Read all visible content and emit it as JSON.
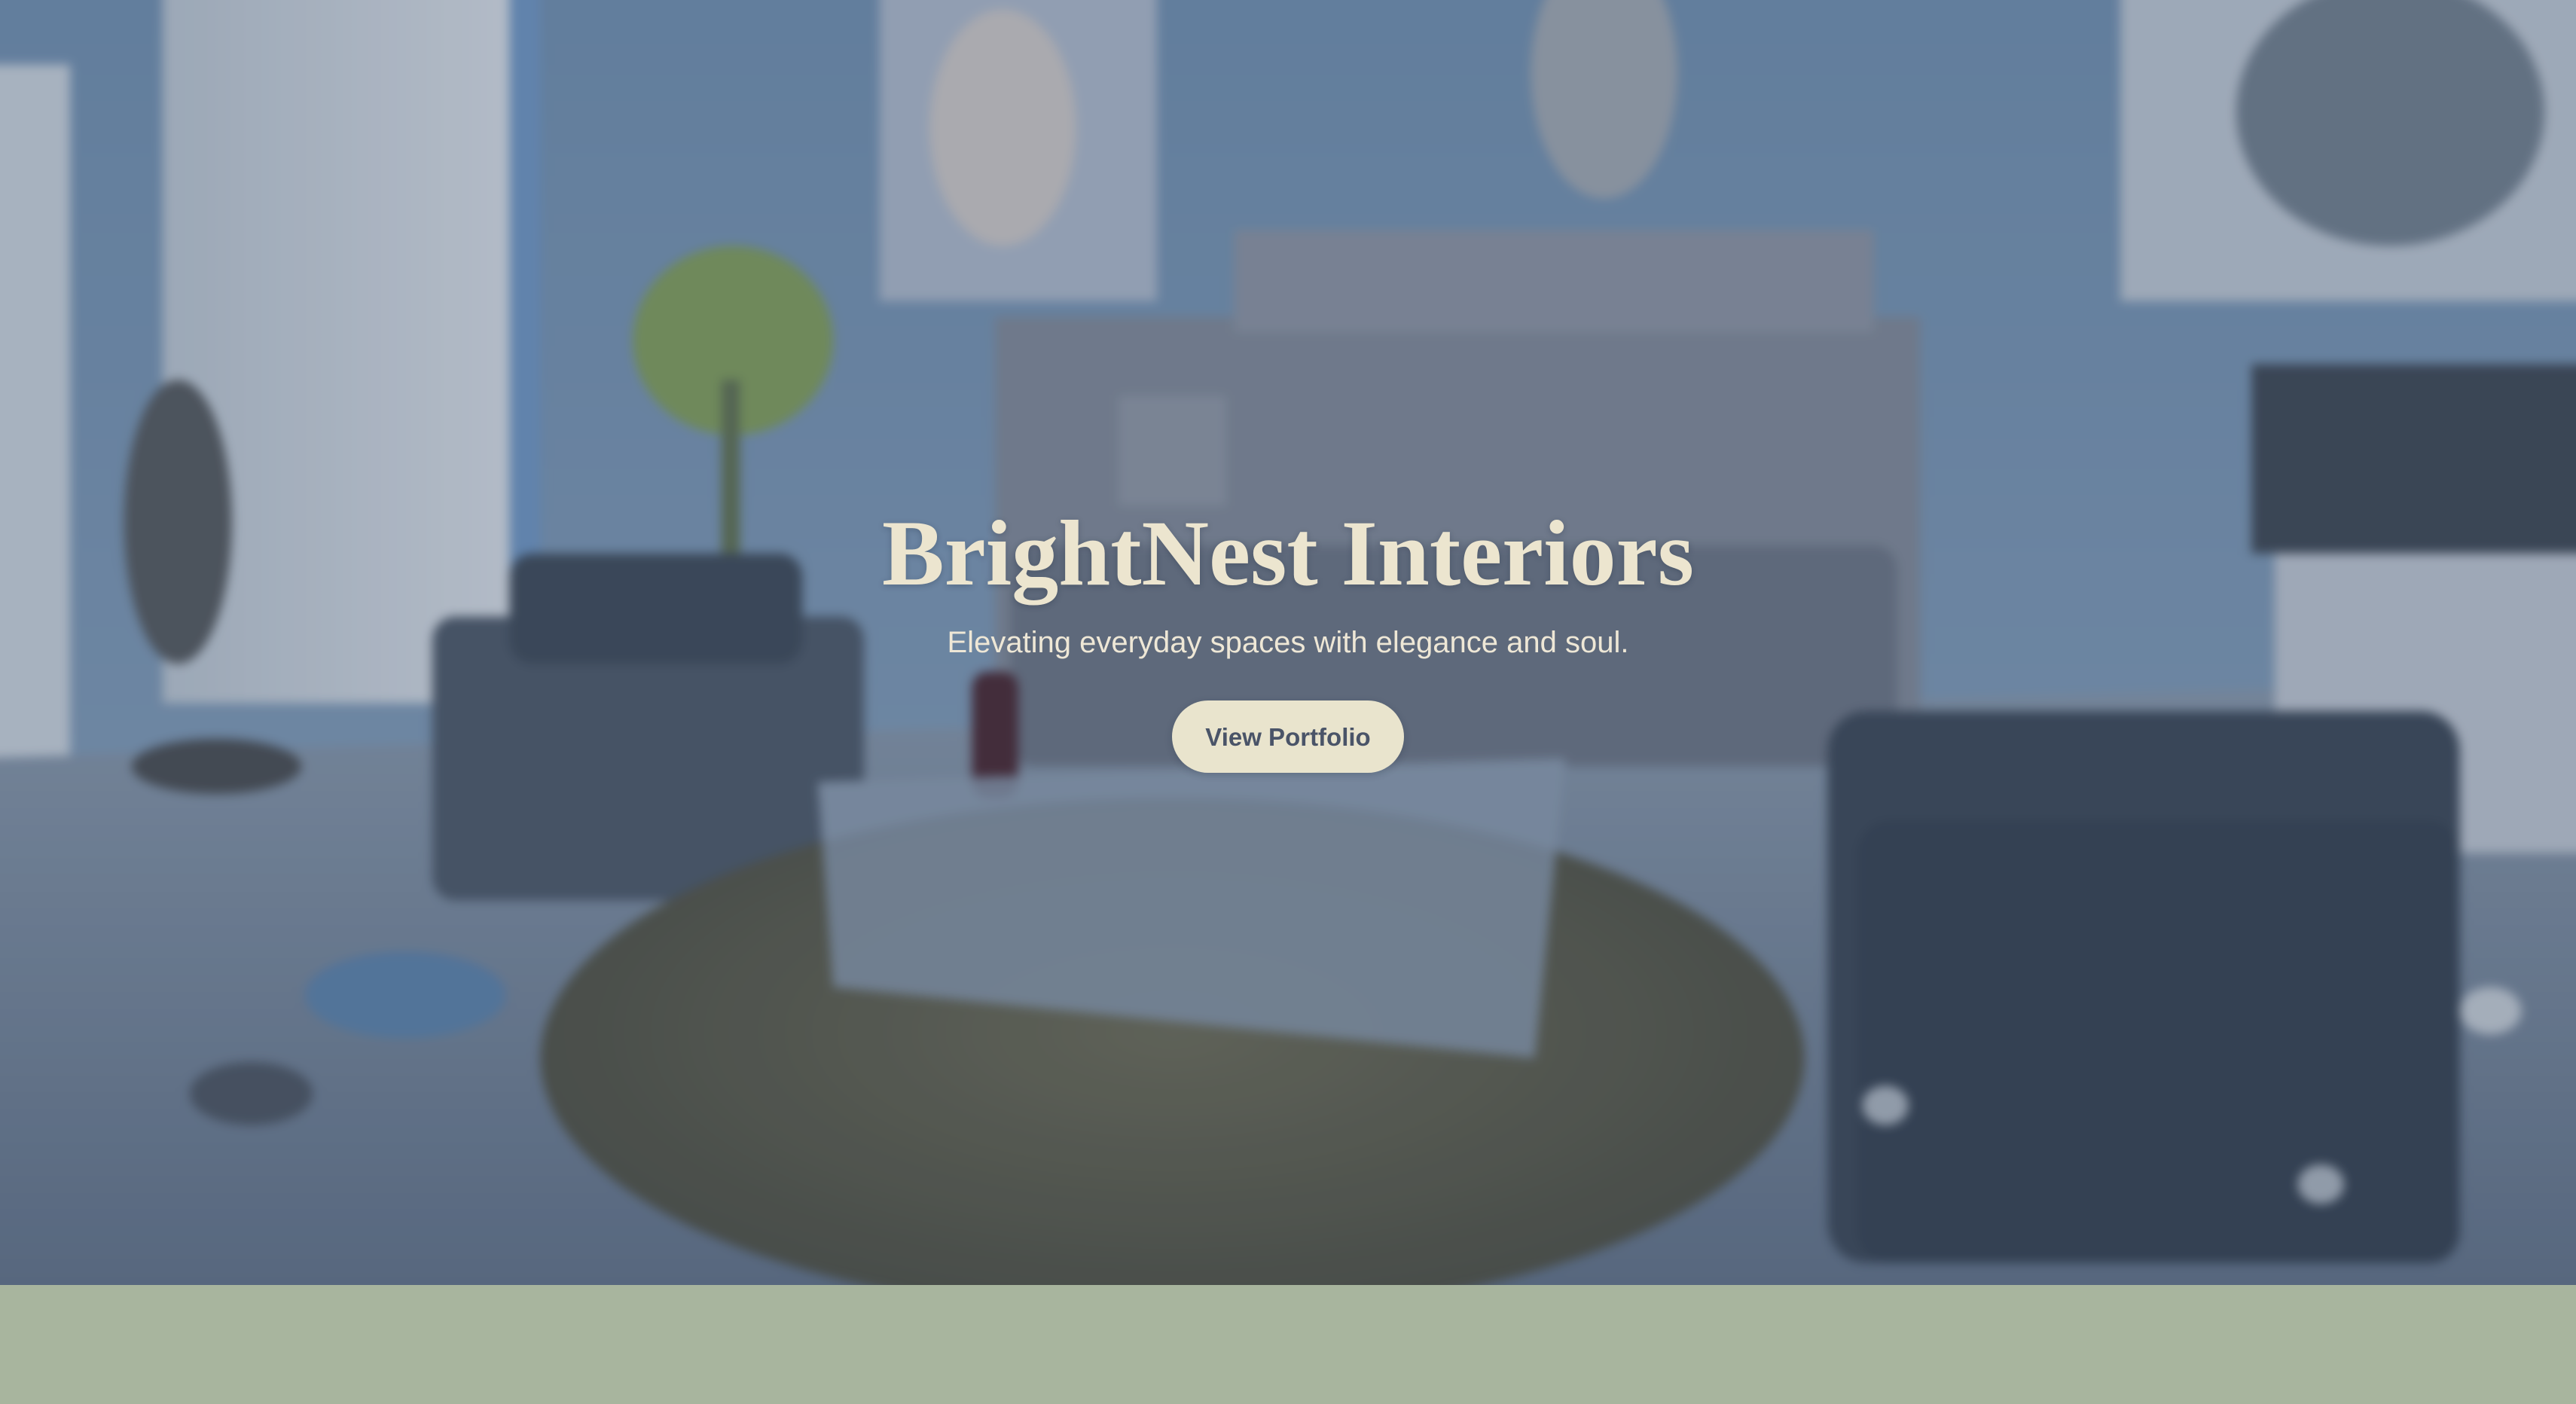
{
  "hero": {
    "title": "BrightNest Interiors",
    "subtitle": "Elevating everyday spaces with elegance and soul.",
    "cta_label": "View Portfolio",
    "background_image": "blurred-living-room-photo"
  },
  "colors": {
    "title_text": "#ece5cf",
    "button_background": "#e9e4cd",
    "button_text": "#4a5468",
    "footer_band": "#a8b59e"
  }
}
